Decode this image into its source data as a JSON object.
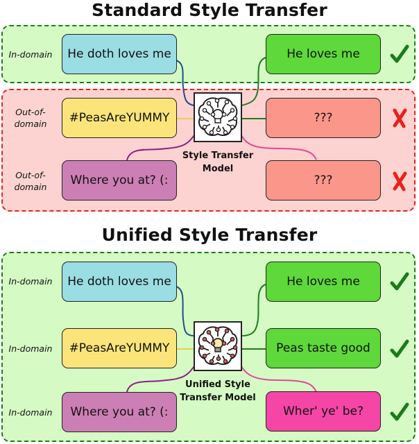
{
  "standard": {
    "title": "Standard Style Transfer",
    "model_label_line1": "Style Transfer",
    "model_label_line2": "Model",
    "model_icon": "brain-circuit-lightbulb-icon",
    "rows": [
      {
        "domain_line1": "In-domain",
        "domain_line2": "",
        "input": "He doth loves me",
        "input_color": "#9adde3",
        "output": "He loves me",
        "output_color": "#5ed83a",
        "result": "check",
        "wire_in": "#1f4f8a",
        "wire_out": "#1f7a1f"
      },
      {
        "domain_line1": "Out-of-",
        "domain_line2": "domain",
        "input": "#PeasAreYUMMY",
        "input_color": "#fbe57a",
        "output": "???",
        "output_color": "#fb978a",
        "result": "cross",
        "wire_in": "#e8d04a",
        "wire_out": "#1f7a1f"
      },
      {
        "domain_line1": "Out-of-",
        "domain_line2": "domain",
        "input": "Where you at? (:",
        "input_color": "#cc7fb5",
        "output": "???",
        "output_color": "#fb978a",
        "result": "cross",
        "wire_in": "#8a1f8a",
        "wire_out": "#e0479e"
      }
    ]
  },
  "unified": {
    "title": "Unified Style Transfer",
    "model_label_line1": "Unified Style",
    "model_label_line2": "Transfer Model",
    "model_icon": "brain-circuit-lightbulb-icon",
    "rows": [
      {
        "domain_line1": "In-domain",
        "domain_line2": "",
        "input": "He doth loves me",
        "input_color": "#9adde3",
        "output": "He loves me",
        "output_color": "#5ed83a",
        "result": "check",
        "wire_in": "#1f4f8a",
        "wire_out": "#1f7a1f"
      },
      {
        "domain_line1": "In-domain",
        "domain_line2": "",
        "input": "#PeasAreYUMMY",
        "input_color": "#fbe57a",
        "output": "Peas taste good",
        "output_color": "#5ed83a",
        "result": "check",
        "wire_in": "#e8d04a",
        "wire_out": "#1f7a1f"
      },
      {
        "domain_line1": "In-domain",
        "domain_line2": "",
        "input": "Where you at? (:",
        "input_color": "#cc7fb5",
        "output": "Wher' ye' be?",
        "output_color": "#f545a6",
        "result": "check",
        "wire_in": "#8a1f8a",
        "wire_out": "#e0479e"
      }
    ]
  },
  "colors": {
    "check": "#1b7a1b",
    "cross": "#e8211b"
  }
}
